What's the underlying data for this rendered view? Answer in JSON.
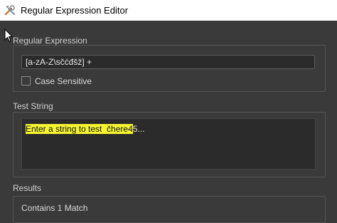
{
  "window": {
    "title": "Regular Expression Editor",
    "icon": "wrench-screwdriver-icon"
  },
  "regex": {
    "label": "Regular Expression",
    "value": "[a-zA-Z\\sčćđšž] +",
    "case_sensitive_label": "Case Sensitive",
    "case_sensitive_checked": false
  },
  "test": {
    "label": "Test String",
    "matched_text": "Enter a string to test  čhere4",
    "remaining_text": "5..."
  },
  "results": {
    "label": "Results",
    "summary": "Contains 1 Match"
  },
  "colors": {
    "background": "#3a3a3a",
    "match_highlight": "#f5f530"
  }
}
